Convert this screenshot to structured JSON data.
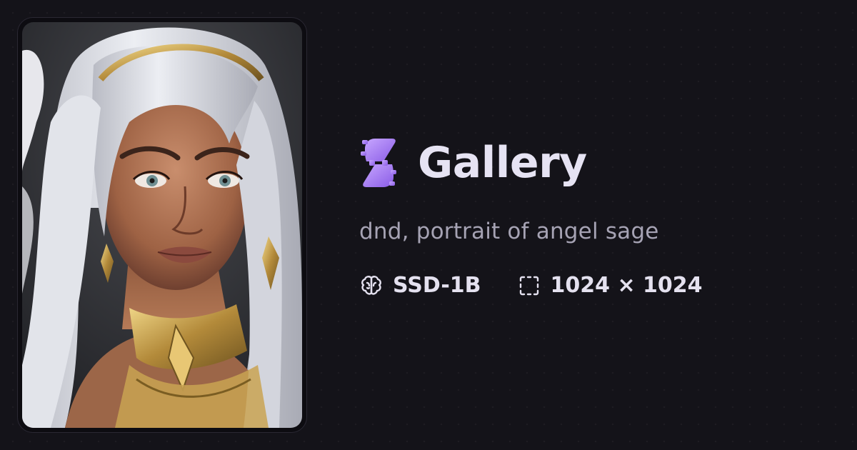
{
  "brand": {
    "name": "Gallery",
    "logo_icon": "purple-gear-s-logo-icon",
    "accent_color": "#a27bf2"
  },
  "image": {
    "alt": "dnd, portrait of angel sage"
  },
  "prompt": "dnd, portrait of angel sage",
  "meta": {
    "model": "SSD-1B",
    "model_icon": "brain-icon",
    "dimensions": "1024 × 1024",
    "dimensions_icon": "dashed-frame-icon"
  }
}
